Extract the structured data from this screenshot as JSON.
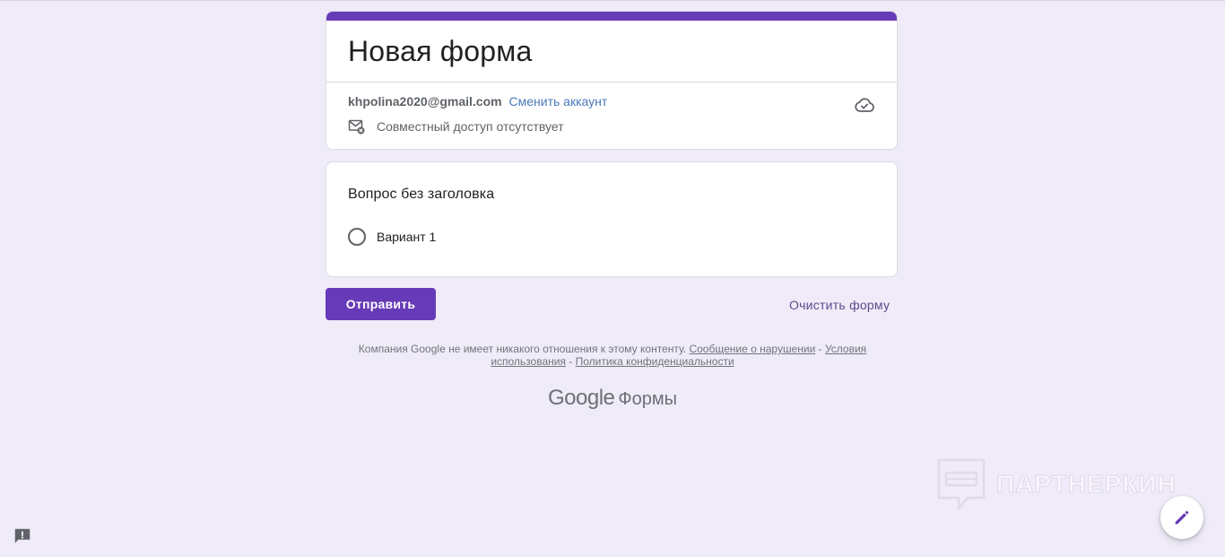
{
  "form": {
    "title": "Новая форма",
    "account_email": "khpolina2020@gmail.com",
    "switch_account_label": "Сменить аккаунт",
    "sharing_status": "Совместный доступ отсутствует",
    "accent_color": "#673ab7"
  },
  "question": {
    "title": "Вопрос без заголовка",
    "options": [
      {
        "label": "Вариант 1"
      }
    ]
  },
  "actions": {
    "submit_label": "Отправить",
    "clear_label": "Очистить форму"
  },
  "footer": {
    "disclaimer_text": "Компания Google не имеет никакого отношения к этому контенту.",
    "report_link": "Сообщение о нарушении",
    "sep1": " - ",
    "terms_link": "Условия использования",
    "sep2": " - ",
    "privacy_link": "Политика конфиденциальности",
    "brand_google": "Google",
    "brand_forms": "Формы"
  },
  "watermark": {
    "text": "ПАРТНЕРКИН"
  },
  "icons": {
    "cloud": "cloud-check-icon",
    "mail": "mail-off-icon",
    "edit": "pencil-icon",
    "feedback": "feedback-icon"
  }
}
